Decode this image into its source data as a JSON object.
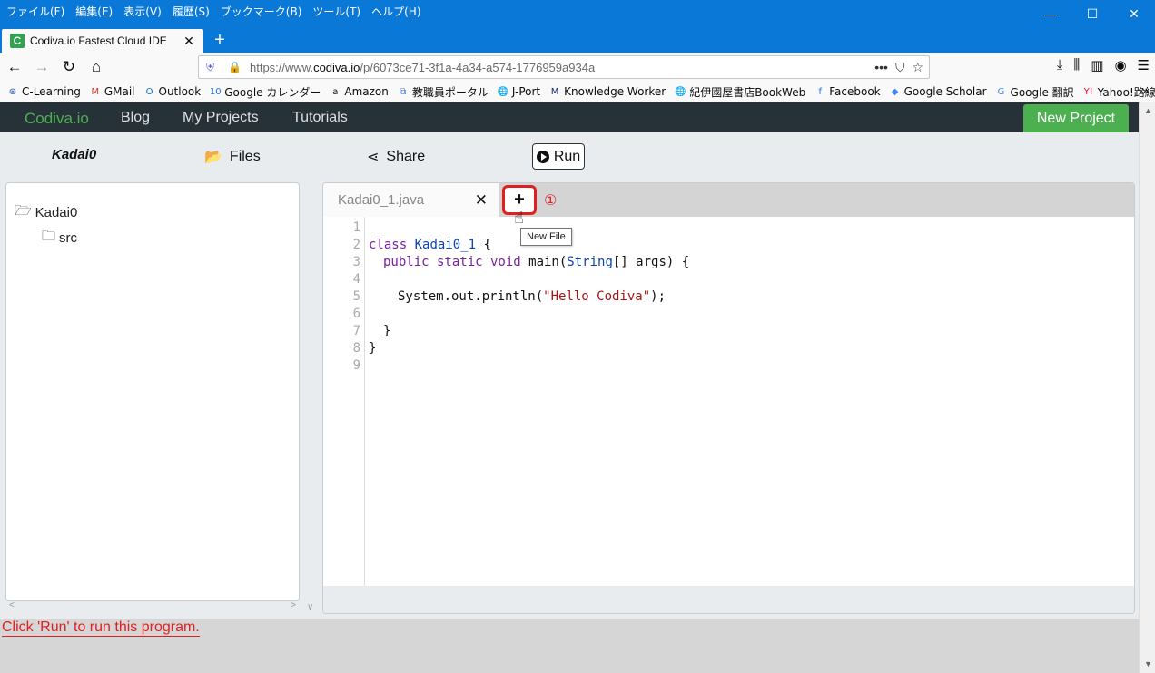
{
  "window": {
    "menu": [
      "ファイル(F)",
      "編集(E)",
      "表示(V)",
      "履歴(S)",
      "ブックマーク(B)",
      "ツール(T)",
      "ヘルプ(H)"
    ],
    "controls": [
      "—",
      "☐",
      "✕"
    ]
  },
  "browser_tab": {
    "favicon": "C",
    "title": "Codiva.io Fastest Cloud IDE",
    "close": "✕",
    "new_tab": "+"
  },
  "nav": {
    "url_prefix": "https://www.",
    "url_domain": "codiva.io",
    "url_path": "/p/6073ce71-3f1a-4a34-a574-1776959a934a",
    "page_actions": "•••"
  },
  "bookmarks": [
    {
      "label": "C-Learning",
      "icon": "c-learning-icon",
      "glyph": "⊛",
      "color": "#1a4f9c"
    },
    {
      "label": "GMail",
      "icon": "gmail-icon",
      "glyph": "M",
      "color": "#d93025"
    },
    {
      "label": "Outlook",
      "icon": "outlook-icon",
      "glyph": "O",
      "color": "#0f6cbd"
    },
    {
      "label": "Google カレンダー",
      "icon": "calendar-icon",
      "glyph": "10",
      "color": "#1a73e8"
    },
    {
      "label": "Amazon",
      "icon": "amazon-icon",
      "glyph": "a",
      "color": "#111111"
    },
    {
      "label": "教職員ポータル",
      "icon": "portal-icon",
      "glyph": "⧉",
      "color": "#3b6fd1"
    },
    {
      "label": "J-Port",
      "icon": "globe-icon",
      "glyph": "🌐",
      "color": "#444444"
    },
    {
      "label": "Knowledge Worker",
      "icon": "knowledge-worker-icon",
      "glyph": "M",
      "color": "#1b2a6b"
    },
    {
      "label": "紀伊國屋書店BookWeb",
      "icon": "globe-icon",
      "glyph": "🌐",
      "color": "#444444"
    },
    {
      "label": "Facebook",
      "icon": "facebook-icon",
      "glyph": "f",
      "color": "#1877f2"
    },
    {
      "label": "Google Scholar",
      "icon": "scholar-icon",
      "glyph": "◆",
      "color": "#4285f4"
    },
    {
      "label": "Google 翻訳",
      "icon": "translate-icon",
      "glyph": "G",
      "color": "#4285f4"
    },
    {
      "label": "Yahoo!路線",
      "icon": "yahoo-icon",
      "glyph": "Y!",
      "color": "#ff0033"
    }
  ],
  "app_nav": {
    "brand": "Codiva.io",
    "links": [
      "Blog",
      "My Projects",
      "Tutorials"
    ],
    "new_project": "New Project"
  },
  "toolbar": {
    "project": "Kadai0",
    "files": "Files",
    "share": "Share",
    "run": "Run"
  },
  "file_tree": {
    "root": "Kadai0",
    "child": "src"
  },
  "editor": {
    "tab_name": "Kadai0_1.java",
    "tab_close": "✕",
    "add_button": "+",
    "marker": "①",
    "tooltip": "New File",
    "line_numbers": [
      "1",
      "2",
      "3",
      "4",
      "5",
      "6",
      "7",
      "8",
      "9"
    ],
    "code": {
      "l2_kw": "class",
      "l2_name": "Kadai0_1",
      "l2_rest": " {",
      "l3_kw": "public static void",
      "l3_mid": " main(",
      "l3_type": "String",
      "l3_rest": "[] args) {",
      "l5_a": "System.out.println(",
      "l5_str": "\"Hello Codiva\"",
      "l5_b": ");",
      "l7": "}",
      "l8": "}"
    }
  },
  "console": {
    "message": "Click 'Run' to run this program."
  }
}
